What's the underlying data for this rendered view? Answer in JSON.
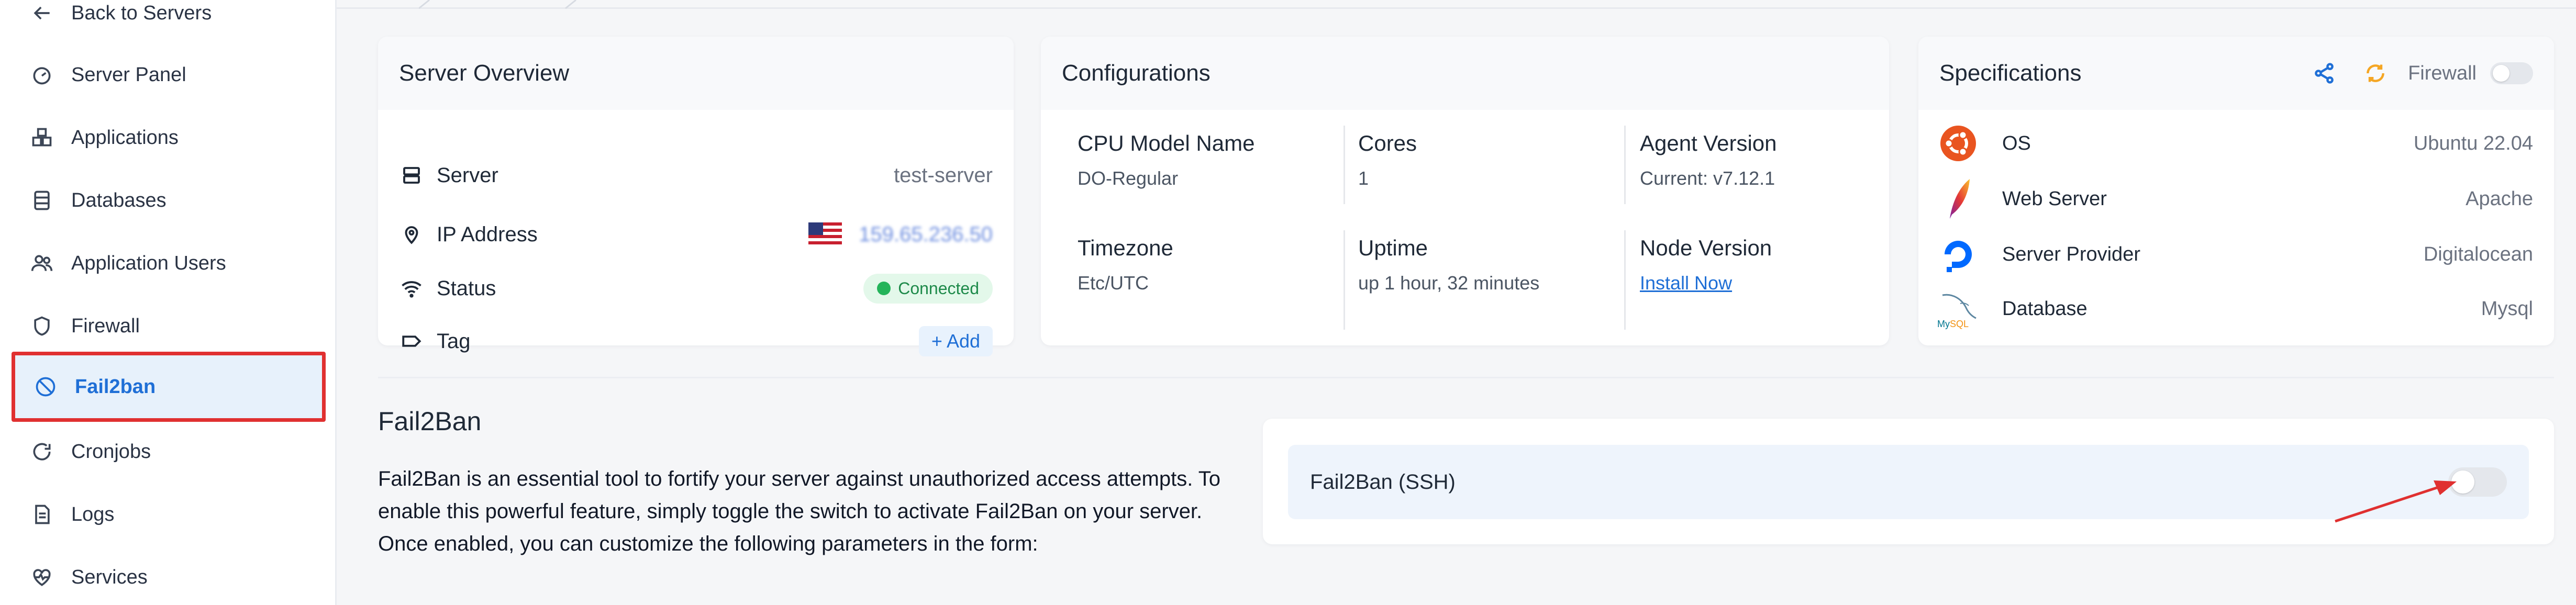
{
  "sidebar": {
    "back": "Back to Servers",
    "items": [
      {
        "label": "Server Panel"
      },
      {
        "label": "Applications"
      },
      {
        "label": "Databases"
      },
      {
        "label": "Application Users"
      },
      {
        "label": "Firewall"
      },
      {
        "label": "Fail2ban"
      },
      {
        "label": "Cronjobs"
      },
      {
        "label": "Logs"
      },
      {
        "label": "Services"
      }
    ]
  },
  "overview": {
    "title": "Server Overview",
    "server_label": "Server",
    "server_value": "test-server",
    "ip_label": "IP Address",
    "ip_value": "159.65.236.50",
    "status_label": "Status",
    "status_value": "Connected",
    "tag_label": "Tag",
    "tag_add": "+ Add"
  },
  "configurations": {
    "title": "Configurations",
    "cpu_label": "CPU Model Name",
    "cpu_value": "DO-Regular",
    "cores_label": "Cores",
    "cores_value": "1",
    "agent_label": "Agent Version",
    "agent_value": "Current: v7.12.1",
    "tz_label": "Timezone",
    "tz_value": "Etc/UTC",
    "uptime_label": "Uptime",
    "uptime_value": "up 1 hour, 32 minutes",
    "node_label": "Node Version",
    "node_value": "Install Now"
  },
  "specifications": {
    "title": "Specifications",
    "firewall_label": "Firewall",
    "os_label": "OS",
    "os_value": "Ubuntu 22.04",
    "web_label": "Web Server",
    "web_value": "Apache",
    "provider_label": "Server Provider",
    "provider_value": "Digitalocean",
    "db_label": "Database",
    "db_value": "Mysql",
    "mysql_logo_text": "MySQL"
  },
  "fail2ban": {
    "title": "Fail2Ban",
    "description": "Fail2Ban is an essential tool to fortify your server against unauthorized access attempts. To enable this powerful feature, simply toggle the switch to activate Fail2Ban on your server. Once enabled, you can customize the following parameters in the form:",
    "ssh_label": "Fail2Ban (SSH)",
    "ssh_enabled": false
  },
  "colors": {
    "accent": "#1f6fd6",
    "highlight_border": "#e03030",
    "connected": "#24b45a"
  }
}
